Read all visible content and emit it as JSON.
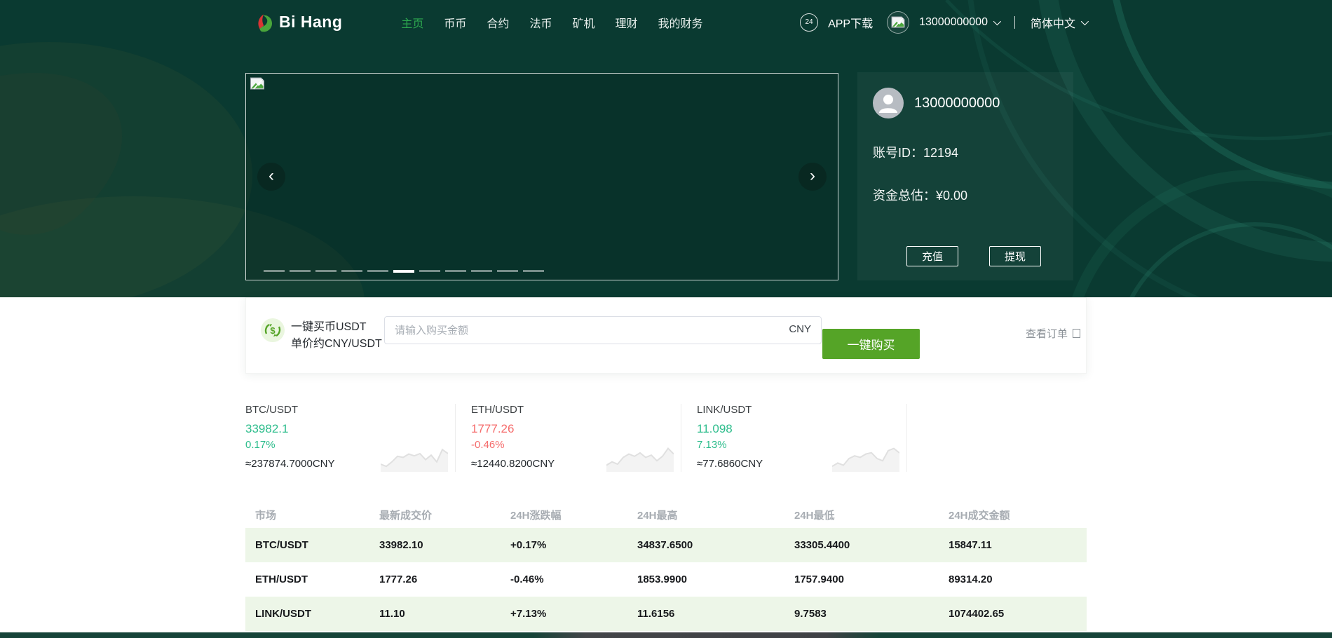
{
  "header": {
    "logo_text": "Bi Hang",
    "nav": [
      "主页",
      "币币",
      "合约",
      "法币",
      "矿机",
      "理财",
      "我的财务"
    ],
    "nav_active_index": 0,
    "service_icon_text": "24",
    "app_download": "APP下载",
    "phone": "13000000000",
    "language": "简体中文"
  },
  "hero": {
    "carousel": {
      "dash_count": 11,
      "active_index": 5
    },
    "user_panel": {
      "phone": "13000000000",
      "account_id_label": "账号ID：",
      "account_id": "12194",
      "assets_label": "资金总估：",
      "assets_value": "¥0.00",
      "recharge_label": "充值",
      "withdraw_label": "提现"
    }
  },
  "buybar": {
    "title_line1": "一键买币USDT",
    "title_line2": "单价约CNY/USDT",
    "placeholder": "请输入购买金额",
    "currency": "CNY",
    "buy_label": "一键购买",
    "orders_label": "查看订单"
  },
  "tickers": [
    {
      "pair": "BTC/USDT",
      "price": "33982.1",
      "change": "0.17%",
      "approx": "≈237874.7000CNY",
      "dir": "up",
      "spark": [
        25,
        15,
        35,
        60,
        55,
        70,
        62,
        72,
        45,
        65,
        35,
        90,
        72
      ]
    },
    {
      "pair": "ETH/USDT",
      "price": "1777.26",
      "change": "-0.46%",
      "approx": "≈12440.8200CNY",
      "dir": "down",
      "spark": [
        20,
        35,
        25,
        55,
        70,
        60,
        75,
        55,
        65,
        40,
        60,
        95,
        70
      ]
    },
    {
      "pair": "LINK/USDT",
      "price": "11.098",
      "change": "7.13%",
      "approx": "≈77.6860CNY",
      "dir": "up",
      "spark": [
        15,
        30,
        20,
        50,
        62,
        55,
        70,
        76,
        50,
        40,
        85,
        95,
        75
      ]
    }
  ],
  "market_table": {
    "headers": [
      "市场",
      "最新成交价",
      "24H涨跌幅",
      "24H最高",
      "24H最低",
      "24H成交金额"
    ],
    "rows": [
      [
        "BTC/USDT",
        "33982.10",
        "+0.17%",
        "34837.6500",
        "33305.4400",
        "15847.11"
      ],
      [
        "ETH/USDT",
        "1777.26",
        "-0.46%",
        "1853.9900",
        "1757.9400",
        "89314.20"
      ],
      [
        "LINK/USDT",
        "11.10",
        "+7.13%",
        "11.6156",
        "9.7583",
        "1074402.65"
      ]
    ]
  },
  "colors": {
    "header_bg": "#0a3a31",
    "nav_active": "#2da94f",
    "buy_button": "#55a427",
    "up": "#2dbd8c",
    "down": "#f56c6c",
    "row_stripe": "#edf6e8"
  }
}
